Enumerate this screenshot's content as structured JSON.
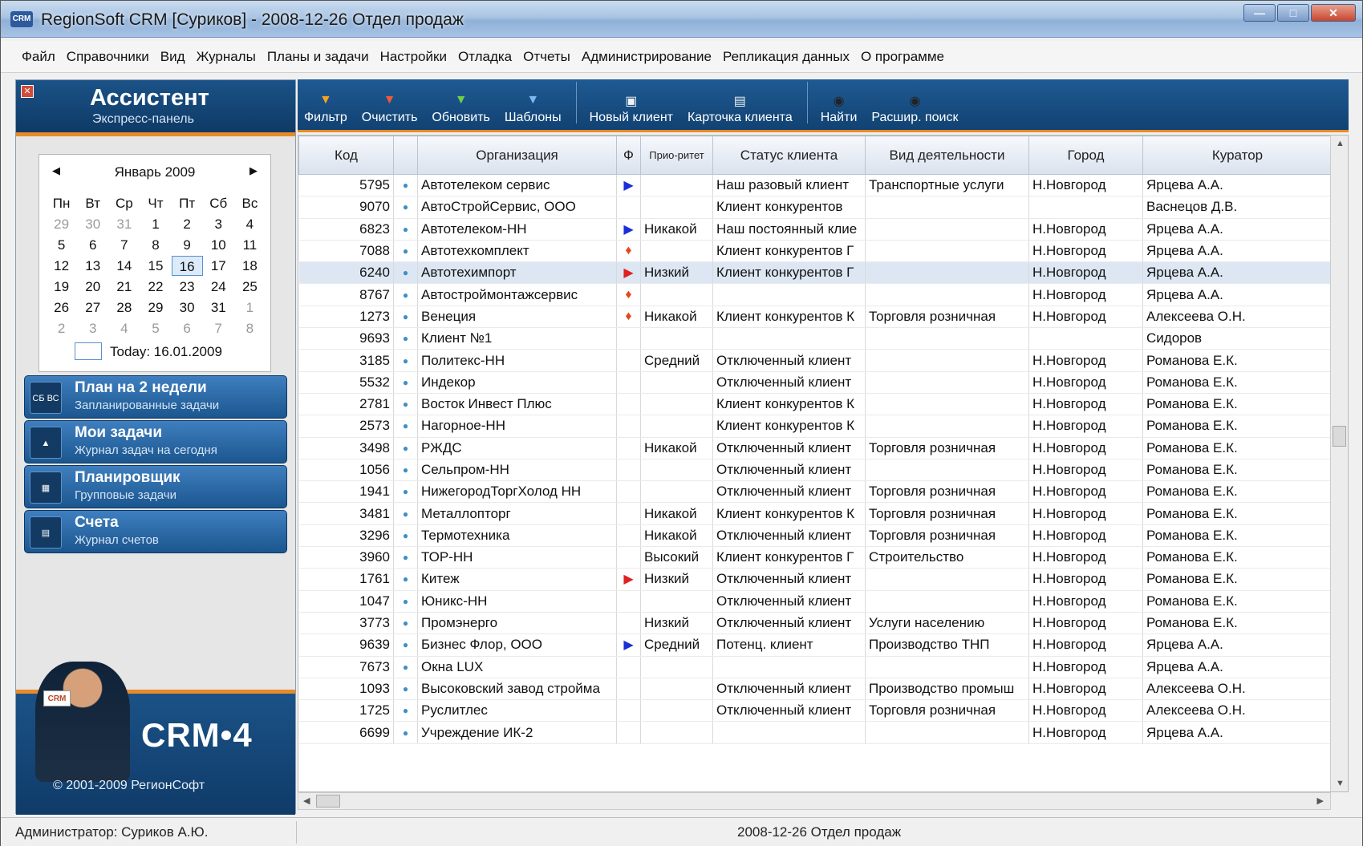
{
  "window": {
    "title": "RegionSoft CRM [Суриков] - 2008-12-26 Отдел продаж",
    "app_icon_text": "CRM"
  },
  "menu": [
    "Файл",
    "Справочники",
    "Вид",
    "Журналы",
    "Планы и задачи",
    "Настройки",
    "Отладка",
    "Отчеты",
    "Администрирование",
    "Репликация данных",
    "О программе"
  ],
  "sidebar": {
    "title": "Ассистент",
    "subtitle": "Экспресс-панель",
    "calendar": {
      "month": "Январь 2009",
      "weekdays": [
        "Пн",
        "Вт",
        "Ср",
        "Чт",
        "Пт",
        "Сб",
        "Вс"
      ],
      "weeks": [
        [
          "29",
          "30",
          "31",
          "1",
          "2",
          "3",
          "4"
        ],
        [
          "5",
          "6",
          "7",
          "8",
          "9",
          "10",
          "11"
        ],
        [
          "12",
          "13",
          "14",
          "15",
          "16",
          "17",
          "18"
        ],
        [
          "19",
          "20",
          "21",
          "22",
          "23",
          "24",
          "25"
        ],
        [
          "26",
          "27",
          "28",
          "29",
          "30",
          "31",
          "1"
        ],
        [
          "2",
          "3",
          "4",
          "5",
          "6",
          "7",
          "8"
        ]
      ],
      "today_label": "Today: 16.01.2009"
    },
    "panels": [
      {
        "title": "План на 2 недели",
        "subtitle": "Запланированные задачи",
        "icon": "calendar-icon"
      },
      {
        "title": "Мои задачи",
        "subtitle": "Журнал задач на сегодня",
        "icon": "tasks-icon"
      },
      {
        "title": "Планировщик",
        "subtitle": "Групповые задачи",
        "icon": "planner-icon"
      },
      {
        "title": "Счета",
        "subtitle": "Журнал счетов",
        "icon": "invoices-icon"
      }
    ],
    "logo": "CRM•4",
    "badge": "CRM",
    "copyright": "© 2001-2009 РегионСофт"
  },
  "toolbar": [
    {
      "label": "Фильтр",
      "icon": "filter-icon"
    },
    {
      "label": "Очистить",
      "icon": "clear-filter-icon"
    },
    {
      "label": "Обновить",
      "icon": "refresh-icon"
    },
    {
      "label": "Шаблоны",
      "icon": "templates-icon"
    },
    {
      "label": "Новый клиент",
      "icon": "new-client-icon"
    },
    {
      "label": "Карточка клиента",
      "icon": "client-card-icon"
    },
    {
      "label": "Найти",
      "icon": "find-icon"
    },
    {
      "label": "Расшир. поиск",
      "icon": "advanced-search-icon"
    }
  ],
  "grid": {
    "columns": [
      "Код",
      "",
      "Организация",
      "Ф",
      "Прио-ритет",
      "Статус клиента",
      "Вид деятельности",
      "Город",
      "Куратор"
    ],
    "rows": [
      {
        "code": "5795",
        "org": "Автотелеком сервис",
        "flag": "blue",
        "prio": "",
        "status": "Наш разовый клиент",
        "activity": "Транспортные услуги",
        "city": "Н.Новгород",
        "curator": "Ярцева А.А."
      },
      {
        "code": "9070",
        "org": "АвтоСтройСервис, ООО",
        "flag": "",
        "prio": "",
        "status": "Клиент конкурентов",
        "activity": "",
        "city": "",
        "curator": "Васнецов Д.В."
      },
      {
        "code": "6823",
        "org": "Автотелеком-НН",
        "flag": "blue",
        "prio": "Никакой",
        "status": "Наш постоянный клие",
        "activity": "",
        "city": "Н.Новгород",
        "curator": "Ярцева А.А."
      },
      {
        "code": "7088",
        "org": "Автотехкомплект",
        "flag": "fire",
        "prio": "",
        "status": "Клиент конкурентов Г",
        "activity": "",
        "city": "Н.Новгород",
        "curator": "Ярцева А.А."
      },
      {
        "code": "6240",
        "org": "Автотехимпорт",
        "flag": "red",
        "prio": "Низкий",
        "status": "Клиент конкурентов Г",
        "activity": "",
        "city": "Н.Новгород",
        "curator": "Ярцева А.А.",
        "selected": true
      },
      {
        "code": "8767",
        "org": "Автостроймонтажсервис",
        "flag": "fire",
        "prio": "",
        "status": "",
        "activity": "",
        "city": "Н.Новгород",
        "curator": "Ярцева А.А."
      },
      {
        "code": "1273",
        "org": "Венеция",
        "flag": "fire",
        "prio": "Никакой",
        "status": "Клиент конкурентов К",
        "activity": "Торговля розничная",
        "city": "Н.Новгород",
        "curator": "Алексеева О.Н."
      },
      {
        "code": "9693",
        "org": "Клиент №1",
        "flag": "",
        "prio": "",
        "status": "",
        "activity": "",
        "city": "",
        "curator": "Сидоров"
      },
      {
        "code": "3185",
        "org": "Политекс-НН",
        "flag": "",
        "prio": "Средний",
        "status": "Отключенный клиент",
        "activity": "",
        "city": "Н.Новгород",
        "curator": "Романова Е.К."
      },
      {
        "code": "5532",
        "org": "Индекор",
        "flag": "",
        "prio": "",
        "status": "Отключенный клиент",
        "activity": "",
        "city": "Н.Новгород",
        "curator": "Романова Е.К."
      },
      {
        "code": "2781",
        "org": "Восток Инвест Плюс",
        "flag": "",
        "prio": "",
        "status": "Клиент конкурентов К",
        "activity": "",
        "city": "Н.Новгород",
        "curator": "Романова Е.К."
      },
      {
        "code": "2573",
        "org": "Нагорное-НН",
        "flag": "",
        "prio": "",
        "status": "Клиент конкурентов К",
        "activity": "",
        "city": "Н.Новгород",
        "curator": "Романова Е.К."
      },
      {
        "code": "3498",
        "org": "РЖДС",
        "flag": "",
        "prio": "Никакой",
        "status": "Отключенный клиент",
        "activity": "Торговля розничная",
        "city": "Н.Новгород",
        "curator": "Романова Е.К."
      },
      {
        "code": "1056",
        "org": "Сельпром-НН",
        "flag": "",
        "prio": "",
        "status": "Отключенный клиент",
        "activity": "",
        "city": "Н.Новгород",
        "curator": "Романова Е.К."
      },
      {
        "code": "1941",
        "org": "НижегородТоргХолод НН",
        "flag": "",
        "prio": "",
        "status": "Отключенный клиент",
        "activity": "Торговля розничная",
        "city": "Н.Новгород",
        "curator": "Романова Е.К."
      },
      {
        "code": "3481",
        "org": "Металлопторг",
        "flag": "",
        "prio": "Никакой",
        "status": "Клиент конкурентов К",
        "activity": "Торговля розничная",
        "city": "Н.Новгород",
        "curator": "Романова Е.К."
      },
      {
        "code": "3296",
        "org": "Термотехника",
        "flag": "",
        "prio": "Никакой",
        "status": "Отключенный клиент",
        "activity": "Торговля розничная",
        "city": "Н.Новгород",
        "curator": "Романова Е.К."
      },
      {
        "code": "3960",
        "org": "ТОР-НН",
        "flag": "",
        "prio": "Высокий",
        "status": "Клиент конкурентов Г",
        "activity": "Строительство",
        "city": "Н.Новгород",
        "curator": "Романова Е.К."
      },
      {
        "code": "1761",
        "org": "Китеж",
        "flag": "red",
        "prio": "Низкий",
        "status": "Отключенный клиент",
        "activity": "",
        "city": "Н.Новгород",
        "curator": "Романова Е.К."
      },
      {
        "code": "1047",
        "org": "Юникс-НН",
        "flag": "",
        "prio": "",
        "status": "Отключенный клиент",
        "activity": "",
        "city": "Н.Новгород",
        "curator": "Романова Е.К."
      },
      {
        "code": "3773",
        "org": "Промэнерго",
        "flag": "",
        "prio": "Низкий",
        "status": "Отключенный клиент",
        "activity": "Услуги населению",
        "city": "Н.Новгород",
        "curator": "Романова Е.К."
      },
      {
        "code": "9639",
        "org": "Бизнес Флор, ООО",
        "flag": "blue",
        "prio": "Средний",
        "status": "Потенц. клиент",
        "activity": "Производство ТНП",
        "city": "Н.Новгород",
        "curator": "Ярцева А.А."
      },
      {
        "code": "7673",
        "org": "Окна LUX",
        "flag": "",
        "prio": "",
        "status": "",
        "activity": "",
        "city": "Н.Новгород",
        "curator": "Ярцева А.А."
      },
      {
        "code": "1093",
        "org": "Высоковский завод стройма",
        "flag": "",
        "prio": "",
        "status": "Отключенный клиент",
        "activity": "Производство промыш",
        "city": "Н.Новгород",
        "curator": "Алексеева О.Н."
      },
      {
        "code": "1725",
        "org": "Руслитлес",
        "flag": "",
        "prio": "",
        "status": "Отключенный клиент",
        "activity": "Торговля розничная",
        "city": "Н.Новгород",
        "curator": "Алексеева О.Н."
      },
      {
        "code": "6699",
        "org": "Учреждение ИК-2",
        "flag": "",
        "prio": "",
        "status": "",
        "activity": "",
        "city": "Н.Новгород",
        "curator": "Ярцева А.А."
      }
    ]
  },
  "status": {
    "user": "Администратор: Суриков А.Ю.",
    "context": "2008-12-26 Отдел продаж"
  }
}
